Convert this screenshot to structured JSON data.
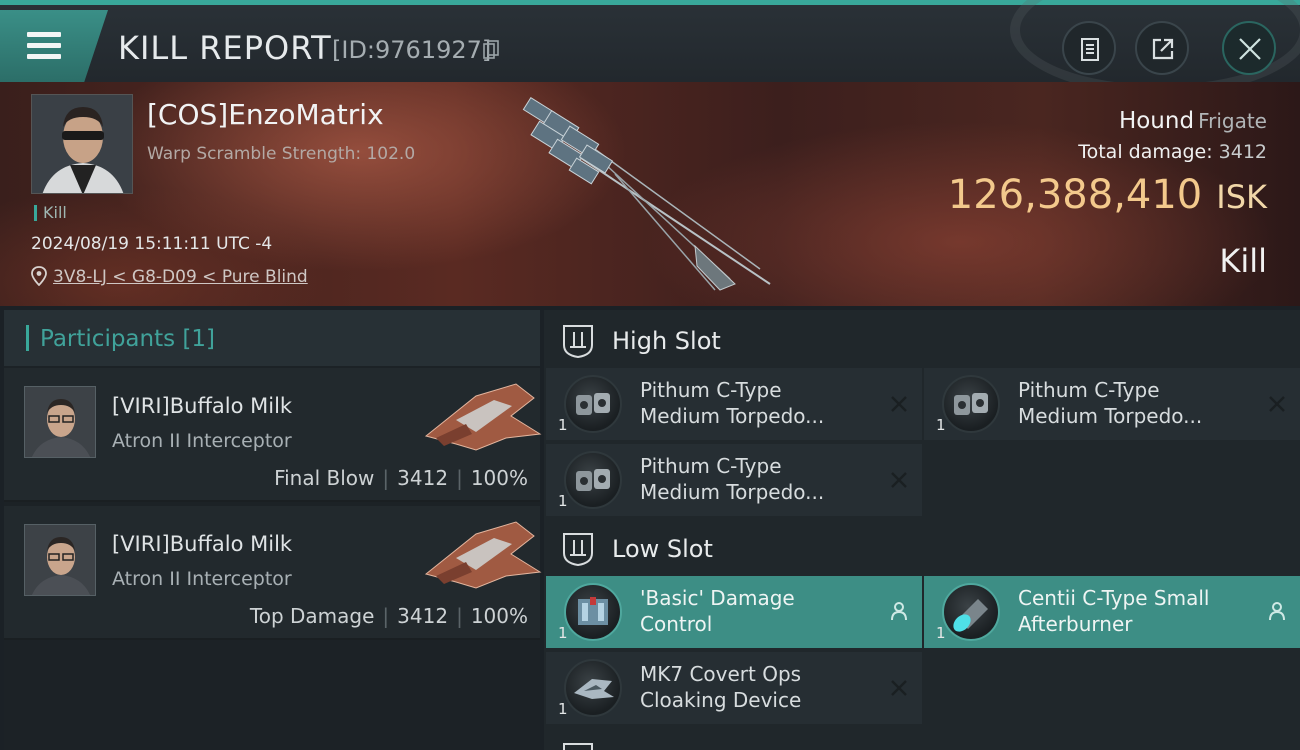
{
  "header": {
    "title": "KILL REPORT",
    "report_id": "[ID:9761927]"
  },
  "victim": {
    "name": "[COS]EnzoMatrix",
    "warp_scramble": "Warp Scramble Strength: 102.0",
    "kill_tag": "Kill",
    "timestamp": "2024/08/19 15:11:11 UTC -4",
    "location": "3V8-LJ < G8-D09 < Pure Blind",
    "ship_name": "Hound",
    "ship_type": "Frigate",
    "total_damage_label": "Total damage:",
    "total_damage": "3412",
    "isk_value": "126,388,410",
    "isk_unit": "ISK",
    "result": "Kill"
  },
  "participants": {
    "title": "Participants [1]",
    "list": [
      {
        "name": "[VIRI]Buffalo Milk",
        "ship": "Atron II Interceptor",
        "role": "Final Blow",
        "damage": "3412",
        "percent": "100%"
      },
      {
        "name": "[VIRI]Buffalo Milk",
        "ship": "Atron II Interceptor",
        "role": "Top Damage",
        "damage": "3412",
        "percent": "100%"
      }
    ]
  },
  "slots": {
    "high": {
      "title": "High Slot",
      "modules": [
        {
          "line1": "Pithum C-Type",
          "line2": "Medium Torpedo...",
          "qty": "1",
          "state": "destroyed"
        },
        {
          "line1": "Pithum C-Type",
          "line2": "Medium Torpedo...",
          "qty": "1",
          "state": "destroyed"
        },
        {
          "line1": "Pithum C-Type",
          "line2": "Medium Torpedo...",
          "qty": "1",
          "state": "destroyed"
        }
      ]
    },
    "low": {
      "title": "Low Slot",
      "modules": [
        {
          "line1": "'Basic' Damage",
          "line2": "Control",
          "qty": "1",
          "state": "dropped"
        },
        {
          "line1": "Centii C-Type Small",
          "line2": "Afterburner",
          "qty": "1",
          "state": "dropped"
        },
        {
          "line1": "MK7 Covert Ops",
          "line2": "Cloaking Device",
          "qty": "1",
          "state": "destroyed"
        }
      ]
    }
  },
  "colors": {
    "accent": "#39a89a",
    "isk": "#f3c98c",
    "fitted_bg": "#3d8e85"
  }
}
